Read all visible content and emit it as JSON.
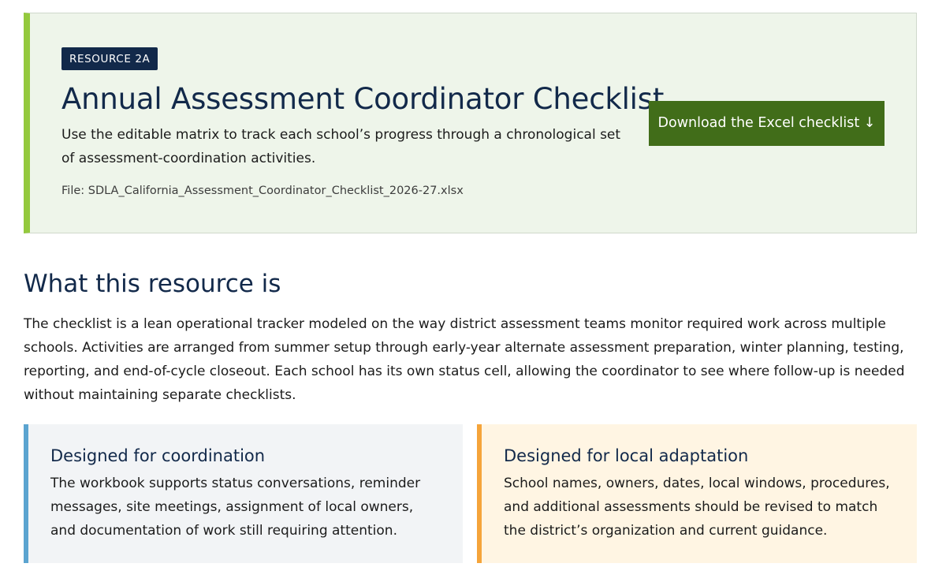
{
  "hero": {
    "tag": "RESOURCE 2A",
    "title": "Annual Assessment Coordinator Checklist",
    "description": "Use the editable matrix to track each school’s progress through a chronological set of assessment-coordination activities.",
    "file": "File: SDLA_California_Assessment_Coordinator_Checklist_2026-27.xlsx",
    "download_label": "Download the Excel checklist ↓",
    "accent_color": "#94c93d",
    "button_color": "#416d19"
  },
  "about": {
    "title": "What this resource is",
    "body": "The checklist is a lean operational tracker modeled on the way district assessment teams monitor required work across multiple schools. Activities are arranged from summer setup through early-year alternate assessment preparation, winter planning, testing, reporting, and end-of-cycle closeout. Each school has its own status cell, allowing the coordinator to see where follow-up is needed without maintaining separate checklists."
  },
  "cards": [
    {
      "title": "Designed for coordination",
      "body": "The workbook supports status conversations, reminder messages, site meetings, assignment of local owners, and documentation of work still requiring attention.",
      "accent_color": "#5ba4d0"
    },
    {
      "title": "Designed for local adaptation",
      "body": "School names, owners, dates, local windows, procedures, and additional assessments should be revised to match the district’s organization and current guidance.",
      "accent_color": "#f5a43a"
    }
  ]
}
